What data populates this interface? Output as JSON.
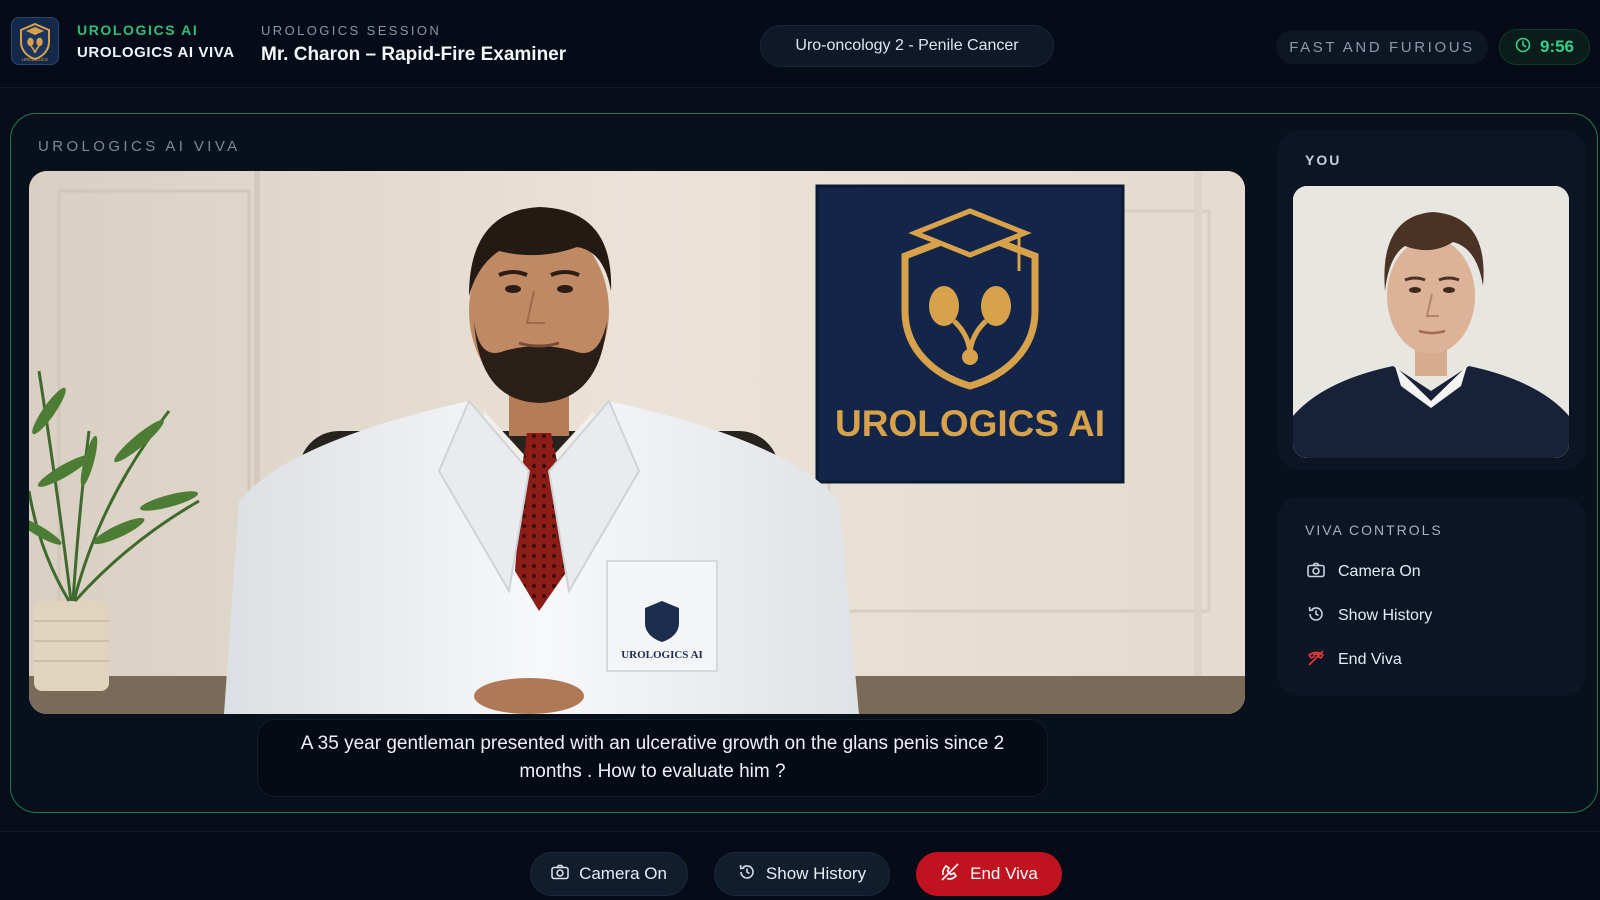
{
  "header": {
    "brand_name": "UROLOGICS AI",
    "brand_sub": "UROLOGICS AI VIVA",
    "logo_text": "UROLOGICS",
    "session_label": "UROLOGICS SESSION",
    "session_title": "Mr. Charon – Rapid-Fire Examiner",
    "topic": "Uro-oncology 2 - Penile Cancer",
    "mode": "FAST AND FURIOUS",
    "timer": "9:56"
  },
  "stage": {
    "label": "UROLOGICS AI VIVA",
    "wall_sign_text": "UROLOGICS AI",
    "coat_badge_text": "UROLOGICS AI",
    "question": "A 35 year gentleman presented with an ulcerative growth on the glans penis since 2 months . How to evaluate him ?"
  },
  "you_panel": {
    "label": "YOU"
  },
  "viva_controls": {
    "title": "VIVA CONTROLS",
    "camera": "Camera On",
    "history": "Show History",
    "end": "End Viva"
  },
  "bottom_bar": {
    "camera": "Camera On",
    "history": "Show History",
    "end": "End Viva"
  },
  "icons": {
    "camera": "camera-icon",
    "history": "history-icon",
    "end": "end-call-icon",
    "timer": "clock-icon"
  },
  "colors": {
    "accent_green": "#2fbf7a",
    "timer_green": "#33d08a",
    "end_red": "#c1121f",
    "sign_navy": "#14254a",
    "sign_gold": "#d8a24a"
  }
}
